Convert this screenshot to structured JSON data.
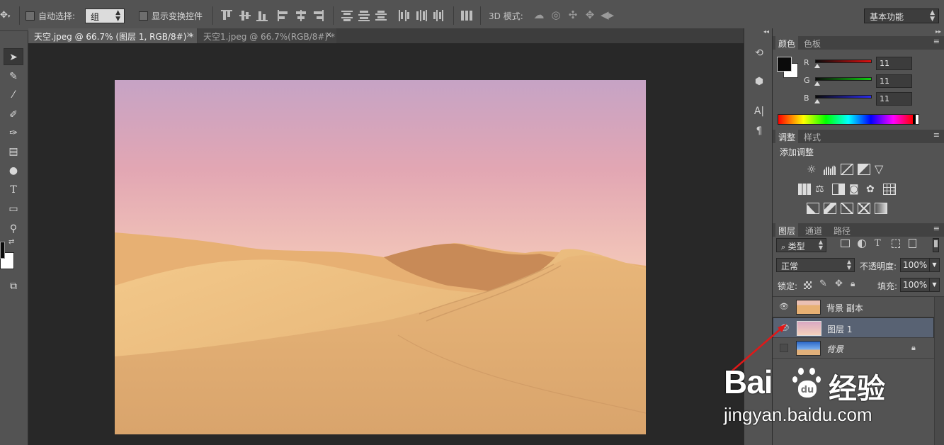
{
  "options_bar": {
    "move_arrow_icon": "move-icon",
    "auto_select_label": "自动选择:",
    "auto_select_value": "组",
    "show_transform_label": "显示变换控件",
    "mode_3d_label": "3D 模式:",
    "workspace_value": "基本功能"
  },
  "tabs": [
    {
      "label": "天空.jpeg @ 66.7% (图层 1, RGB/8#) *",
      "active": true
    },
    {
      "label": "天空1.jpeg @ 66.7%(RGB/8#) *",
      "active": false
    }
  ],
  "color_panel": {
    "tabs": [
      "颜色",
      "色板"
    ],
    "r_label": "R",
    "r_value": "11",
    "g_label": "G",
    "g_value": "11",
    "b_label": "B",
    "b_value": "11",
    "foreground_color": "#0b0b0b",
    "background_color": "#ffffff"
  },
  "adjustments_panel": {
    "tabs": [
      "调整",
      "样式"
    ],
    "title": "添加调整"
  },
  "layers_panel": {
    "tabs": [
      "图层",
      "通道",
      "路径"
    ],
    "filter_value": "类型",
    "blend_mode": "正常",
    "opacity_label": "不透明度:",
    "opacity_value": "100%",
    "lock_label": "锁定:",
    "fill_label": "填充:",
    "fill_value": "100%",
    "layers": [
      {
        "name": "背景 副本",
        "visible": true,
        "selected": false,
        "locked": false
      },
      {
        "name": "图层 1",
        "visible": true,
        "selected": true,
        "locked": false
      },
      {
        "name": "背景",
        "visible": false,
        "selected": false,
        "locked": true
      }
    ]
  },
  "watermark": {
    "brand": "Bai",
    "brand2": "经验",
    "url": "jingyan.baidu.com"
  },
  "colors": {
    "ui_bg": "#535353",
    "canvas_bg": "#282828",
    "selected_layer": "#586273"
  }
}
